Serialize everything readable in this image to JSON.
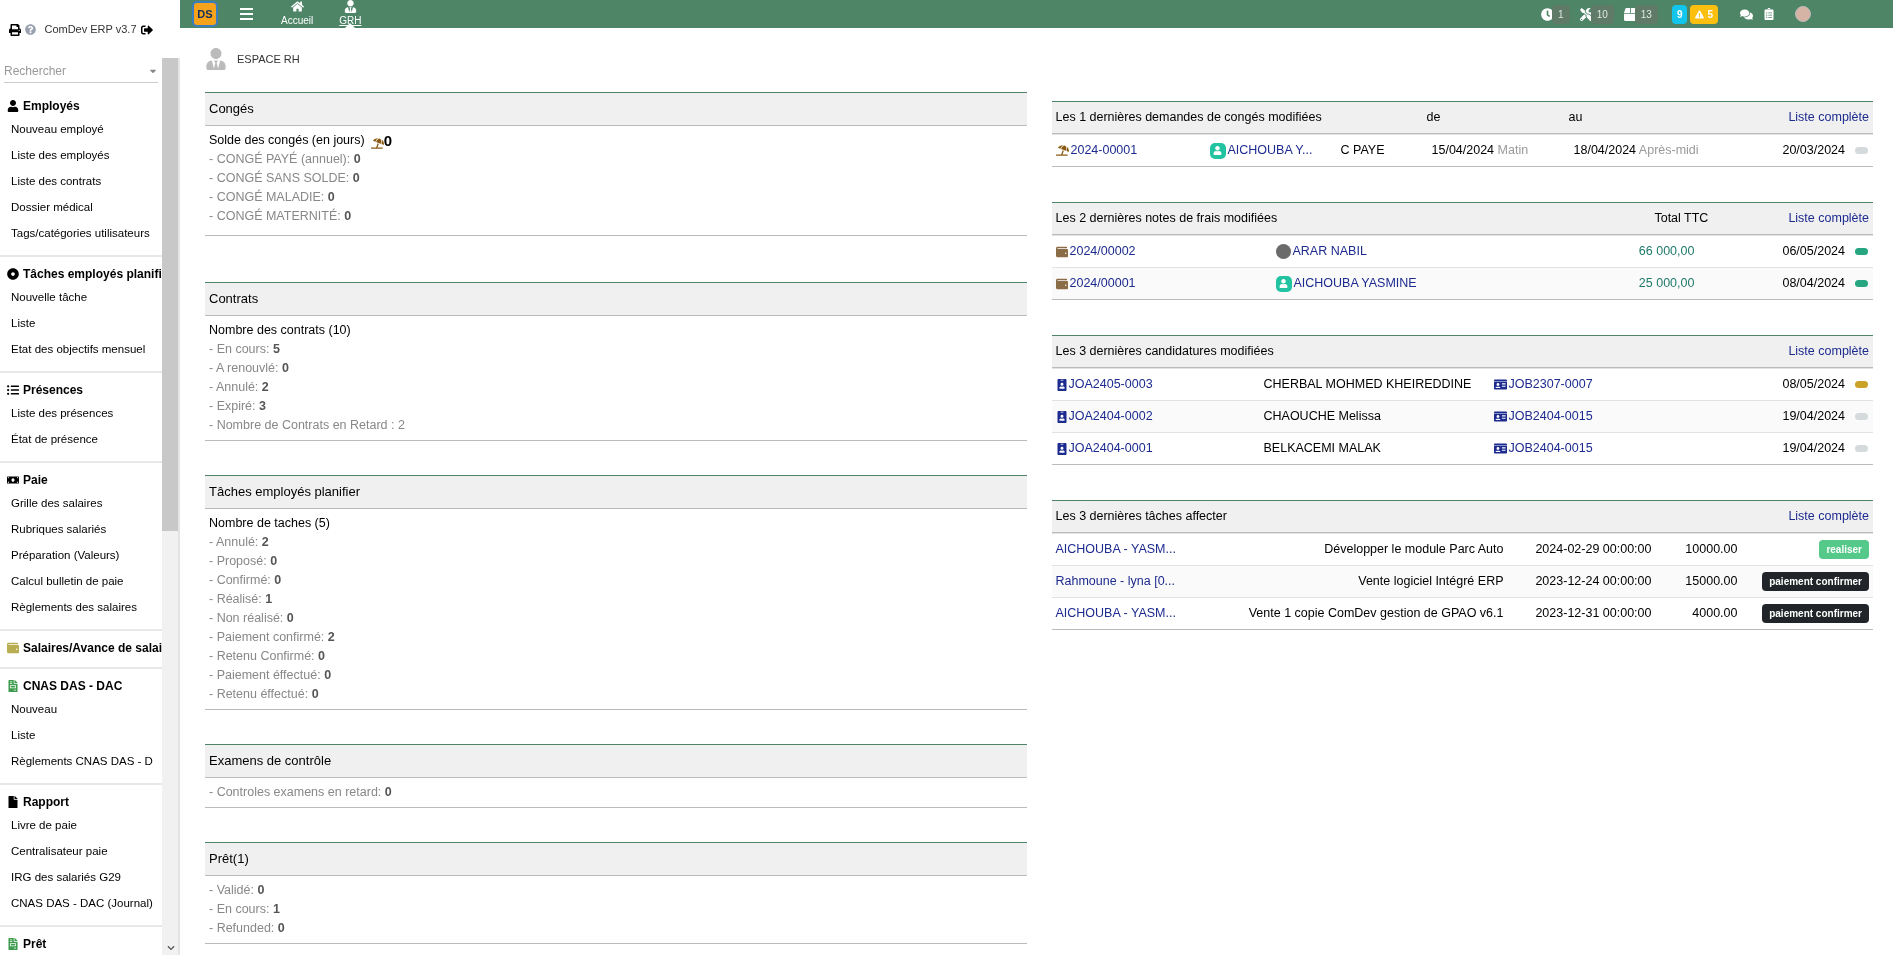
{
  "sidebar": {
    "app_name": "ComDev ERP v3.7",
    "search": {
      "placeholder": "Rechercher"
    },
    "sections": [
      {
        "title": "Employés",
        "items": [
          "Nouveau employé",
          "Liste des employés",
          "Liste des contrats",
          "Dossier médical",
          "Tags/catégories utilisateurs"
        ]
      },
      {
        "title": "Tâches employés planifi",
        "items": [
          "Nouvelle tâche",
          "Liste",
          "Etat des objectifs mensuel"
        ]
      },
      {
        "title": "Présences",
        "items": [
          "Liste des présences",
          "État de présence"
        ]
      },
      {
        "title": "Paie",
        "items": [
          "Grille des salaires",
          "Rubriques salariés",
          "Préparation (Valeurs)",
          "Calcul bulletin de paie",
          "Règlements des salaires"
        ]
      },
      {
        "title": "Salaires/Avance de salai"
      },
      {
        "title": "CNAS DAS - DAC",
        "items": [
          "Nouveau",
          "Liste",
          "Règlements CNAS DAS - D"
        ]
      },
      {
        "title": "Rapport",
        "items": [
          "Livre de paie",
          "Centralisateur paie",
          "IRG des salariés G29",
          "CNAS DAS - DAC (Journal)"
        ]
      },
      {
        "title": "Prêt"
      }
    ]
  },
  "top_bar": {
    "logo": "DS",
    "nav": [
      {
        "label": "Accueil",
        "selected": false
      },
      {
        "label": "GRH",
        "selected": true
      }
    ],
    "counters": [
      {
        "value": "1"
      },
      {
        "value": "10"
      },
      {
        "value": "13"
      }
    ],
    "alerts": [
      {
        "value": "9",
        "color": "#12c5ec"
      },
      {
        "value": "5",
        "color": "#fbbf0f"
      }
    ]
  },
  "page_title": "ESPACE RH",
  "panels": [
    {
      "title": "Congés",
      "summary": "Solde des congés (en jours)",
      "summary_value": "0",
      "lines": [
        "- CONGÉ PAYÉ (annuel): **0**",
        "- CONGÉ SANS SOLDE: **0**",
        "- CONGÉ MALADIE: **0**",
        "- CONGÉ MATERNITÉ: **0**"
      ]
    },
    {
      "title": "Contrats",
      "summary": "Nombre des contrats (10)",
      "lines": [
        "- En cours: **5**",
        "- A renouvlé: **0**",
        "- Annulé: **2**",
        "- Expiré: **3**",
        "- Nombre de Contrats en Retard : 2"
      ]
    },
    {
      "title": "Tâches employés planifier",
      "summary": "Nombre de taches (5)",
      "lines": [
        "- Annulé: **2**",
        "- Proposé: **0**",
        "- Confirmé: **0**",
        "- Réalisé: **1**",
        "- Non réalisé: **0**",
        "- Paiement confirmé: **2**",
        "- Retenu Confirmé: **0**",
        "- Paiement éffectué: **0**",
        "- Retenu éffectué: **0**"
      ]
    },
    {
      "title": "Examens de contrôle",
      "lines": [
        "- Controles examens en retard: **0**"
      ]
    },
    {
      "title": "Prêt(1)",
      "lines": [
        "- Validé: **0**",
        "- En cours: **1**",
        "- Refunded: **0**"
      ]
    }
  ],
  "leave_requests": {
    "title": "Les 1 dernières demandes de congés modifiées",
    "col_from": "de",
    "col_to": "au",
    "link": "Liste complète",
    "rows": [
      {
        "ref": "2024-00001",
        "employee": "AICHOUBA Y...",
        "has_photo": false,
        "type": "C PAYE",
        "from_date": "15/04/2024",
        "from_period": "Matin",
        "to_date": "18/04/2024",
        "to_period": "Après-midi",
        "modified": "20/03/2024",
        "color": "#d5dadd"
      }
    ]
  },
  "expense_reports": {
    "title": "Les 2 dernières notes de frais modifiées",
    "col_total": "Total TTC",
    "link": "Liste complète",
    "rows": [
      {
        "ref": "2024/00002",
        "employee": "ARAR NABIL",
        "has_photo": true,
        "total": "66 000,00",
        "date": "06/05/2024",
        "color": "#25a580"
      },
      {
        "ref": "2024/00001",
        "employee": "AICHOUBA YASMINE",
        "has_photo": false,
        "total": "25 000,00",
        "date": "08/04/2024",
        "color": "#25a580"
      }
    ]
  },
  "applications": {
    "title": "Les 3 dernières candidatures modifiées",
    "link": "Liste complète",
    "rows": [
      {
        "ref": "JOA2405-0003",
        "candidate": "CHERBAL MOHMED KHEIREDDINE",
        "job": "JOB2307-0007",
        "date": "08/05/2024",
        "color": "#c9a227"
      },
      {
        "ref": "JOA2404-0002",
        "candidate": "CHAOUCHE Melissa",
        "job": "JOB2404-0015",
        "date": "19/04/2024",
        "color": "#d5dadd"
      },
      {
        "ref": "JOA2404-0001",
        "candidate": "BELKACEMI MALAK",
        "job": "JOB2404-0015",
        "date": "19/04/2024",
        "color": "#d5dadd"
      }
    ]
  },
  "assigned_tasks": {
    "title": "Les 3 dernières tâches affecter",
    "link": "Liste complète",
    "rows": [
      {
        "assignee": "AICHOUBA - YASM...",
        "description": "Développer le module Parc Auto",
        "datetime": "2024-02-29 00:00:00",
        "amount": "10000.00",
        "status": "realiser",
        "color": "#55c98a"
      },
      {
        "assignee": "Rahmoune - lyna [0...",
        "description": "Vente logiciel Intégré ERP",
        "datetime": "2023-12-24 00:00:00",
        "amount": "15000.00",
        "status": "paiement confirmer",
        "color": "#212529"
      },
      {
        "assignee": "AICHOUBA - YASM...",
        "description": "Vente 1 copie ComDev gestion de GPAO v6.1",
        "datetime": "2023-12-31 00:00:00",
        "amount": "4000.00",
        "status": "paiement confirmer",
        "color": "#212529"
      }
    ]
  }
}
